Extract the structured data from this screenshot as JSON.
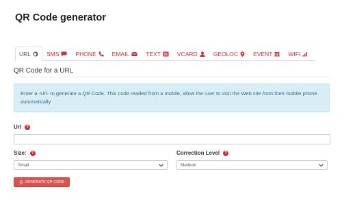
{
  "page": {
    "title": "QR Code generator"
  },
  "tabs": [
    {
      "label": "URL",
      "icon": "globe-icon",
      "active": true
    },
    {
      "label": "SMS",
      "icon": "comment-icon"
    },
    {
      "label": "PHONE",
      "icon": "phone-icon"
    },
    {
      "label": "EMAIL",
      "icon": "envelope-icon"
    },
    {
      "label": "TEXT",
      "icon": "text-icon"
    },
    {
      "label": "VCARD",
      "icon": "user-icon"
    },
    {
      "label": "GEOLOC",
      "icon": "map-marker-icon"
    },
    {
      "label": "EVENT",
      "icon": "calendar-icon"
    },
    {
      "label": "WIFI",
      "icon": "signal-icon"
    }
  ],
  "section": {
    "title": "QR Code for a URL"
  },
  "info": {
    "text": "Enter a -Url- to generate a QR Code. This code readed from a mobile, allow the user to visit the Web site from their mobile phone automatically"
  },
  "url_field": {
    "label": "Url",
    "value": "",
    "placeholder": ""
  },
  "size_field": {
    "label": "Size:",
    "selected": "Small"
  },
  "correction_field": {
    "label": "Correction Level",
    "selected": "Medium"
  },
  "generate_button": {
    "label": "GENERATE QR CODE",
    "icon": "refresh-icon"
  },
  "colors": {
    "accent": "#c7303b",
    "info_bg": "#d9edf7",
    "info_text": "#31708f",
    "button_bg": "#d9534f"
  }
}
